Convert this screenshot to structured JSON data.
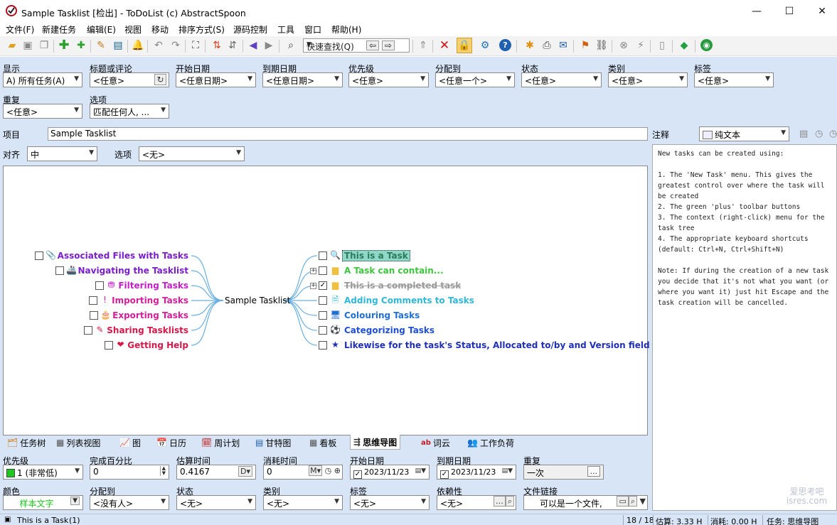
{
  "window": {
    "title": "Sample Tasklist [检出] - ToDoList (c) AbstractSpoon",
    "minimize": "—",
    "maximize": "☐",
    "close": "✕"
  },
  "menu": [
    "文件(F)",
    "新建任务",
    "编辑(E)",
    "视图",
    "移动",
    "排序方式(S)",
    "源码控制",
    "工具",
    "窗口",
    "帮助(H)"
  ],
  "toolbar": {
    "quickfind": "快速查找(Q)"
  },
  "filters": {
    "show": {
      "label": "显示",
      "value": "A)  所有任务(A)"
    },
    "title": {
      "label": "标题或评论",
      "value": "<任意>"
    },
    "start": {
      "label": "开始日期",
      "value": "<任意日期>"
    },
    "due": {
      "label": "到期日期",
      "value": "<任意日期>"
    },
    "priority": {
      "label": "优先级",
      "value": "<任意>"
    },
    "alloc": {
      "label": "分配到",
      "value": "<任意一个>"
    },
    "status": {
      "label": "状态",
      "value": "<任意>"
    },
    "category": {
      "label": "类别",
      "value": "<任意>"
    },
    "tags": {
      "label": "标签",
      "value": "<任意>"
    },
    "recur": {
      "label": "重复",
      "value": "<任意>"
    },
    "options": {
      "label": "选项",
      "value": "匹配任何人, ..."
    }
  },
  "project": {
    "label": "项目",
    "value": "Sample Tasklist"
  },
  "align": {
    "label": "对齐",
    "value": "中",
    "opt_label": "选项",
    "opt_value": "<无>"
  },
  "mindmap": {
    "root": "Sample Tasklist",
    "left": [
      {
        "label": "Associated Files with Tasks",
        "color": "#7a1fc9",
        "icon": "📎"
      },
      {
        "label": "Navigating the Tasklist",
        "color": "#7a1fc9",
        "icon": "🚢"
      },
      {
        "label": "Filtering Tasks",
        "color": "#c41fc9",
        "icon": "⛃"
      },
      {
        "label": "Importing Tasks",
        "color": "#d41f9a",
        "icon": "!"
      },
      {
        "label": "Exporting Tasks",
        "color": "#d41f9a",
        "icon": "🎂"
      },
      {
        "label": "Sharing Tasklists",
        "color": "#d4194a",
        "icon": "✎"
      },
      {
        "label": "Getting Help",
        "color": "#d4194a",
        "icon": "❤"
      }
    ],
    "right": [
      {
        "label": "This is a Task",
        "color": "#2b7a5a",
        "icon": "🔍",
        "selected": true
      },
      {
        "label": "A Task can contain...",
        "color": "#3ec43e",
        "icon": "▆",
        "expand": "+"
      },
      {
        "label": "This is a completed task",
        "color": "#9a9a9a",
        "icon": "▆",
        "expand": "+",
        "done": true,
        "check": "✓"
      },
      {
        "label": "Adding Comments to Tasks",
        "color": "#2fb8d8",
        "icon": "🗎"
      },
      {
        "label": "Colouring Tasks",
        "color": "#1f6fd4",
        "icon": "🖥"
      },
      {
        "label": "Categorizing Tasks",
        "color": "#1f4fd4",
        "icon": "⚽"
      },
      {
        "label": "Likewise for the task's Status, Allocated to/by and Version fields",
        "color": "#1f2fb8",
        "icon": "★"
      }
    ]
  },
  "tabs": [
    {
      "label": "任务树",
      "icon": "🗂"
    },
    {
      "label": "列表视图",
      "icon": "▦"
    },
    {
      "label": "图",
      "icon": "📈"
    },
    {
      "label": "日历",
      "icon": "📅"
    },
    {
      "label": "周计划",
      "icon": "🗓"
    },
    {
      "label": "甘特图",
      "icon": "▤"
    },
    {
      "label": "看板",
      "icon": "▦"
    },
    {
      "label": "思维导图",
      "icon": "⇶",
      "active": true
    },
    {
      "label": "词云",
      "icon": "ab"
    },
    {
      "label": "工作负荷",
      "icon": "👥"
    }
  ],
  "fields": {
    "priority": {
      "label": "优先级",
      "value": "1 (非常低)"
    },
    "percent": {
      "label": "完成百分比",
      "value": "0"
    },
    "est": {
      "label": "估算时间",
      "value": "0.4167",
      "unit": "D"
    },
    "spent": {
      "label": "消耗时间",
      "value": "0",
      "unit": "M"
    },
    "start": {
      "label": "开始日期",
      "value": "2023/11/23"
    },
    "due": {
      "label": "到期日期",
      "value": "2023/11/23"
    },
    "recur": {
      "label": "重复",
      "value": "一次",
      "btn": "..."
    },
    "color": {
      "label": "颜色",
      "value": "样本文字"
    },
    "alloc": {
      "label": "分配到",
      "value": "<没有人>"
    },
    "status": {
      "label": "状态",
      "value": "<无>"
    },
    "category": {
      "label": "类别",
      "value": "<无>"
    },
    "tags": {
      "label": "标签",
      "value": "<无>"
    },
    "depend": {
      "label": "依赖性",
      "value": "<无>"
    },
    "filelink": {
      "label": "文件链接",
      "value": "可以是一个文件,"
    }
  },
  "notes": {
    "label": "注释",
    "format": "纯文本",
    "text": "New tasks can be created using:\n\n1. The 'New Task' menu. This gives the greatest control over where the task will be created\n2. The green 'plus' toolbar buttons\n3. The context (right-click) menu for the task tree\n4. The appropriate keyboard shortcuts (default: Ctrl+N, Ctrl+Shift+N)\n\nNote: If during the creation of a new task you decide that it's not what you want (or where you want it) just hit Escape and the task creation will be cancelled."
  },
  "status": {
    "task": "This is a Task",
    "count": "(1)",
    "pos": "18 / 18",
    "est": "估算: 3.33 H",
    "spent": "消耗: 0.00 H",
    "view": "任务: 思维导图"
  },
  "watermark": "爱思考吧 isres.com"
}
